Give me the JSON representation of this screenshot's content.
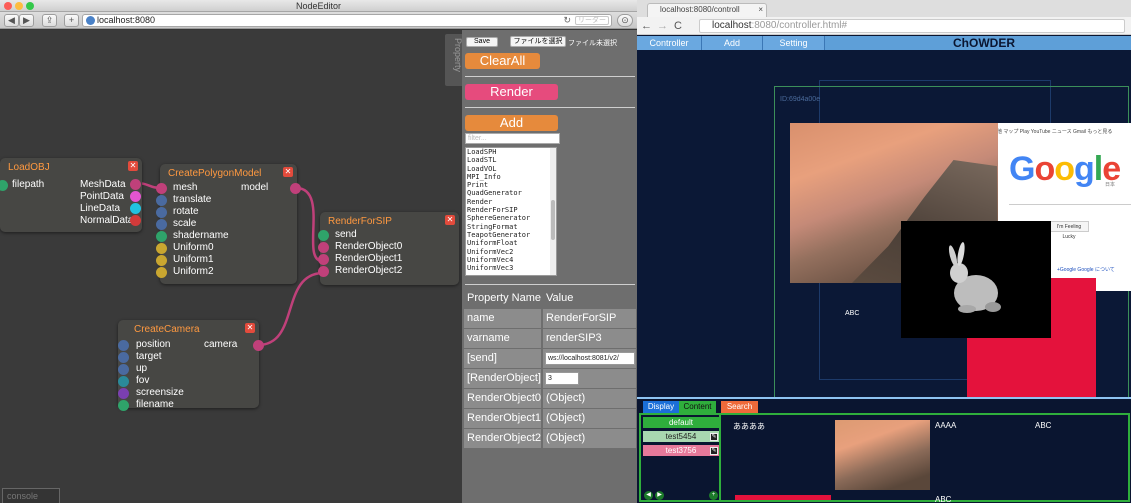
{
  "left_window": {
    "title": "NodeEditor",
    "url": "localhost:8080",
    "reader_label": "リーダー",
    "console_label": "console",
    "property_tab_label": "Property"
  },
  "nodes": {
    "loadobj": {
      "title": "LoadOBJ",
      "inputs": [
        "filepath"
      ],
      "outputs": [
        "MeshData",
        "PointData",
        "LineData",
        "NormalData"
      ]
    },
    "createpolygon": {
      "title": "CreatePolygonModel",
      "inputs": [
        "mesh",
        "translate",
        "rotate",
        "scale",
        "shadername",
        "Uniform0",
        "Uniform1",
        "Uniform2"
      ],
      "outputs": [
        "model"
      ]
    },
    "renderforsip": {
      "title": "RenderForSIP",
      "inputs": [
        "send",
        "RenderObject0",
        "RenderObject1",
        "RenderObject2"
      ]
    },
    "createcamera": {
      "title": "CreateCamera",
      "inputs": [
        "position",
        "target",
        "up",
        "fov",
        "screensize",
        "filename"
      ],
      "outputs": [
        "camera"
      ]
    }
  },
  "panel": {
    "save_label": "Save",
    "file_button_label": "ファイルを選択",
    "file_status": "ファイル未選択",
    "clearall_label": "ClearAll",
    "render_label": "Render",
    "add_label": "Add",
    "filter_placeholder": "filter...",
    "node_list": [
      "LoadSPH",
      "LoadSTL",
      "LoadVOL",
      "MPI_Info",
      "Print",
      "QuadGenerator",
      "Render",
      "RenderForSIP",
      "SphereGenerator",
      "StringFormat",
      "TeapotGenerator",
      "UniformFloat",
      "UniformVec2",
      "UniformVec4",
      "UniformVec3"
    ],
    "table_header": {
      "name": "Property Name",
      "value": "Value"
    },
    "properties": [
      {
        "key": "name",
        "value": "RenderForSIP"
      },
      {
        "key": "varname",
        "value": "renderSIP3"
      },
      {
        "key": "[send]",
        "value": "ws://localhost:8081/v2/"
      },
      {
        "key": "[RenderObject]",
        "value": "3"
      },
      {
        "key": "RenderObject0",
        "value": "(Object)"
      },
      {
        "key": "RenderObject1",
        "value": "(Object)"
      },
      {
        "key": "RenderObject2",
        "value": "(Object)"
      }
    ]
  },
  "right_window": {
    "tab_title": "localhost:8080/controll",
    "url_host": "localhost",
    "url_rest": ":8080/controller.html#",
    "menu": [
      "Controller",
      "Add",
      "Setting"
    ],
    "app_title": "ChOWDER",
    "display_id": "ID:69d4a00e",
    "google_bar": "他  マップ  Play  YouTube  ニュース  Gmail  もっと見る",
    "google_logo": "Google",
    "google_sub": "日本",
    "lucky_label": "I'm Feeling Lucky",
    "google_links": "+Google    Google について",
    "abc_label": "ABC",
    "tabs": [
      "Display",
      "Content",
      "Search"
    ],
    "content_list": [
      "default",
      "test5454",
      "test3756"
    ],
    "content_text": [
      "ああああ",
      "AAAA",
      "ABC",
      "ABC"
    ]
  },
  "colors": {
    "node_title": "#ff9940",
    "wire": "#c0407a",
    "clearall": "#e68a3c",
    "render": "#e64b7d",
    "add": "#e68a3c",
    "accent_green": "#2fae3c",
    "chowder_menu": "#5e9fd8",
    "red_rect": "#e4123c"
  }
}
